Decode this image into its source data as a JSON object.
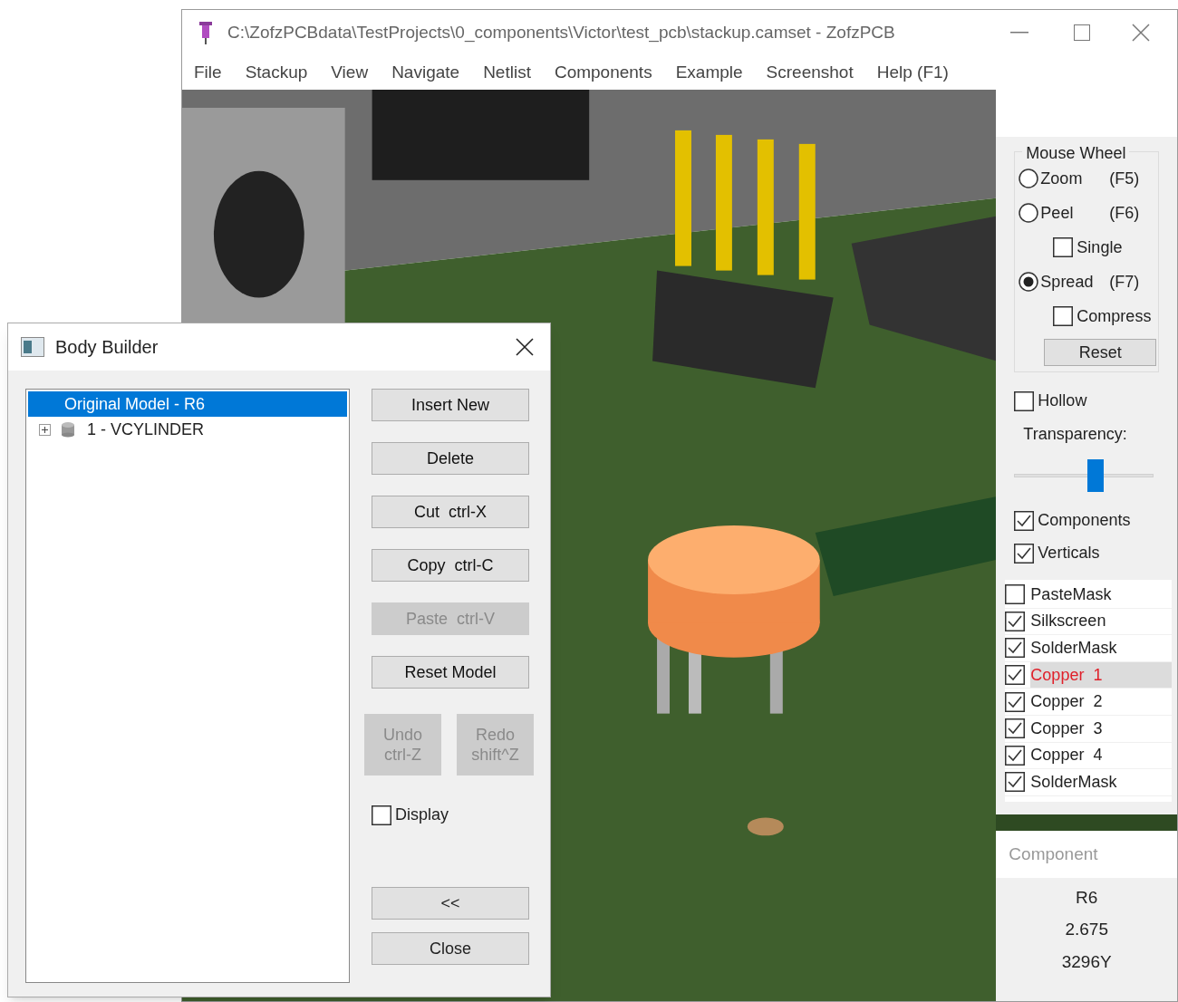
{
  "window": {
    "title": "C:\\ZofzPCBdata\\TestProjects\\0_components\\Victor\\test_pcb\\stackup.camset - ZofzPCB"
  },
  "menu": [
    "File",
    "Stackup",
    "View",
    "Navigate",
    "Netlist",
    "Components",
    "Example",
    "Screenshot",
    "Help (F1)"
  ],
  "mouse_wheel": {
    "title": "Mouse Wheel",
    "options": [
      {
        "kind": "radio",
        "label": "Zoom",
        "shortcut": "(F5)",
        "selected": false
      },
      {
        "kind": "radio",
        "label": "Peel",
        "shortcut": "(F6)",
        "selected": false
      },
      {
        "kind": "checkbox",
        "label": "Single",
        "checked": false
      },
      {
        "kind": "radio",
        "label": "Spread",
        "shortcut": "(F7)",
        "selected": true
      },
      {
        "kind": "checkbox",
        "label": "Compress",
        "checked": false
      }
    ],
    "reset_button": "Reset"
  },
  "hollow": {
    "label": "Hollow",
    "checked": false
  },
  "transparency": {
    "label": "Transparency:",
    "level": 0.59
  },
  "view_options": [
    {
      "label": "Components",
      "checked": true
    },
    {
      "label": "Verticals",
      "checked": true
    }
  ],
  "layers": [
    {
      "label": "PasteMask",
      "checked": false,
      "selected": false
    },
    {
      "label": "Silkscreen",
      "checked": true,
      "selected": false
    },
    {
      "label": "SolderMask",
      "checked": true,
      "selected": false
    },
    {
      "label": "Copper  1",
      "checked": true,
      "selected": true
    },
    {
      "label": "Copper  2",
      "checked": true,
      "selected": false
    },
    {
      "label": "Copper  3",
      "checked": true,
      "selected": false
    },
    {
      "label": "Copper  4",
      "checked": true,
      "selected": false
    },
    {
      "label": "SolderMask",
      "checked": true,
      "selected": false
    }
  ],
  "component": {
    "title": "Component",
    "values": [
      "R6",
      "2.675",
      "3296Y"
    ]
  },
  "dialog": {
    "title": "Body Builder",
    "tree": [
      {
        "label": "Original Model - R6",
        "selected": true,
        "children": [
          {
            "label": "1 - VCYLINDER",
            "selected": false,
            "expanded": false
          }
        ]
      }
    ],
    "buttons": [
      {
        "kind": "wide",
        "label": "Insert New",
        "disabled": false
      },
      {
        "kind": "wide",
        "label": "Delete",
        "disabled": false
      },
      {
        "kind": "wide",
        "label": "Cut  ctrl-X",
        "disabled": false
      },
      {
        "kind": "wide",
        "label": "Copy  ctrl-C",
        "disabled": false
      },
      {
        "kind": "wide",
        "label": "Paste  ctrl-V",
        "disabled": true
      },
      {
        "kind": "wide",
        "label": "Reset Model",
        "disabled": false
      },
      {
        "kind": "half",
        "label": "Undo\nctrl-Z",
        "disabled": true
      },
      {
        "kind": "half",
        "label": "Redo\nshift^Z",
        "disabled": true
      }
    ],
    "display": {
      "label": "Display",
      "checked": false
    },
    "bottom_buttons": [
      "<<",
      "Close"
    ]
  }
}
